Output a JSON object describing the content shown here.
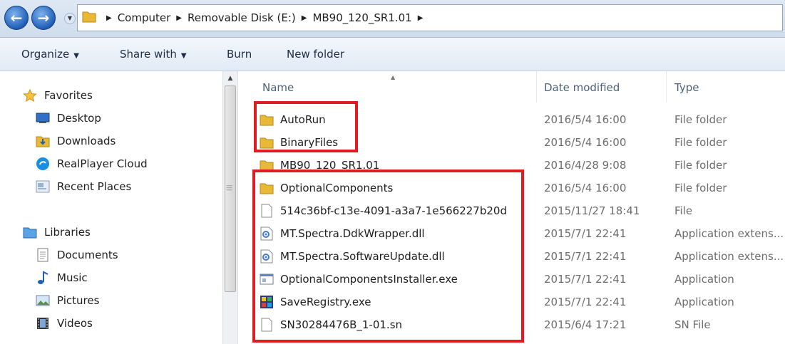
{
  "address_bar": {
    "breadcrumbs": [
      "Computer",
      "Removable Disk (E:)",
      "MB90_120_SR1.01"
    ]
  },
  "toolbar": {
    "organize": "Organize",
    "share_with": "Share with",
    "burn": "Burn",
    "new_folder": "New folder"
  },
  "nav": {
    "favorites": {
      "label": "Favorites",
      "items": [
        {
          "label": "Desktop",
          "icon": "desktop-icon"
        },
        {
          "label": "Downloads",
          "icon": "downloads-icon"
        },
        {
          "label": "RealPlayer Cloud",
          "icon": "realplayer-icon"
        },
        {
          "label": "Recent Places",
          "icon": "recent-places-icon"
        }
      ]
    },
    "libraries": {
      "label": "Libraries",
      "items": [
        {
          "label": "Documents",
          "icon": "documents-icon"
        },
        {
          "label": "Music",
          "icon": "music-icon"
        },
        {
          "label": "Pictures",
          "icon": "pictures-icon"
        },
        {
          "label": "Videos",
          "icon": "videos-icon"
        }
      ]
    }
  },
  "columns": {
    "name": "Name",
    "date": "Date modified",
    "type": "Type"
  },
  "files": [
    {
      "name": "AutoRun",
      "date": "2016/5/4 16:00",
      "type": "File folder",
      "icon": "folder-icon"
    },
    {
      "name": "BinaryFiles",
      "date": "2016/5/4 16:00",
      "type": "File folder",
      "icon": "folder-icon"
    },
    {
      "name": "MB90_120_SR1.01",
      "date": "2016/4/28 9:08",
      "type": "File folder",
      "icon": "folder-icon"
    },
    {
      "name": "OptionalComponents",
      "date": "2016/5/4 16:00",
      "type": "File folder",
      "icon": "folder-icon"
    },
    {
      "name": "514c36bf-c13e-4091-a3a7-1e566227b20d",
      "date": "2015/11/27 18:41",
      "type": "File",
      "icon": "file-icon"
    },
    {
      "name": "MT.Spectra.DdkWrapper.dll",
      "date": "2015/7/1 22:41",
      "type": "Application extens...",
      "icon": "dll-icon"
    },
    {
      "name": "MT.Spectra.SoftwareUpdate.dll",
      "date": "2015/7/1 22:41",
      "type": "Application extens...",
      "icon": "dll-icon"
    },
    {
      "name": "OptionalComponentsInstaller.exe",
      "date": "2015/7/1 22:41",
      "type": "Application",
      "icon": "exe-icon"
    },
    {
      "name": "SaveRegistry.exe",
      "date": "2015/7/1 22:41",
      "type": "Application",
      "icon": "saveregistry-icon"
    },
    {
      "name": "SN30284476B_1-01.sn",
      "date": "2015/6/4 17:21",
      "type": "SN File",
      "icon": "file-icon"
    }
  ],
  "colors": {
    "highlight": "#e11b22",
    "folder": "#e8b935"
  }
}
